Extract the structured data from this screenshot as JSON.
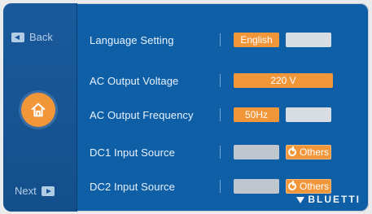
{
  "nav": {
    "back_label": "Back",
    "next_label": "Next"
  },
  "settings": [
    {
      "label": "Language Setting",
      "options": [
        {
          "label": "English",
          "state": "active"
        },
        {
          "label": "",
          "state": "inactive"
        }
      ]
    },
    {
      "label": "AC Output Voltage",
      "options": [
        {
          "label": "220 V",
          "state": "active"
        }
      ]
    },
    {
      "label": "AC Output Frequency",
      "options": [
        {
          "label": "50Hz",
          "state": "active"
        },
        {
          "label": "",
          "state": "inactive"
        }
      ]
    },
    {
      "label": "DC1 Input Source",
      "options": [
        {
          "label": "",
          "state": "inactive"
        },
        {
          "label": "Others",
          "state": "active",
          "icon": "power-icon"
        }
      ]
    },
    {
      "label": "DC2 Input Source",
      "options": [
        {
          "label": "",
          "state": "inactive"
        },
        {
          "label": "Others",
          "state": "active",
          "icon": "power-icon"
        }
      ]
    }
  ],
  "brand": {
    "name": "BLUETTI"
  },
  "colors": {
    "background": "#0f5fa6",
    "accent": "#f2963a",
    "inactive": "#d8dde3"
  }
}
